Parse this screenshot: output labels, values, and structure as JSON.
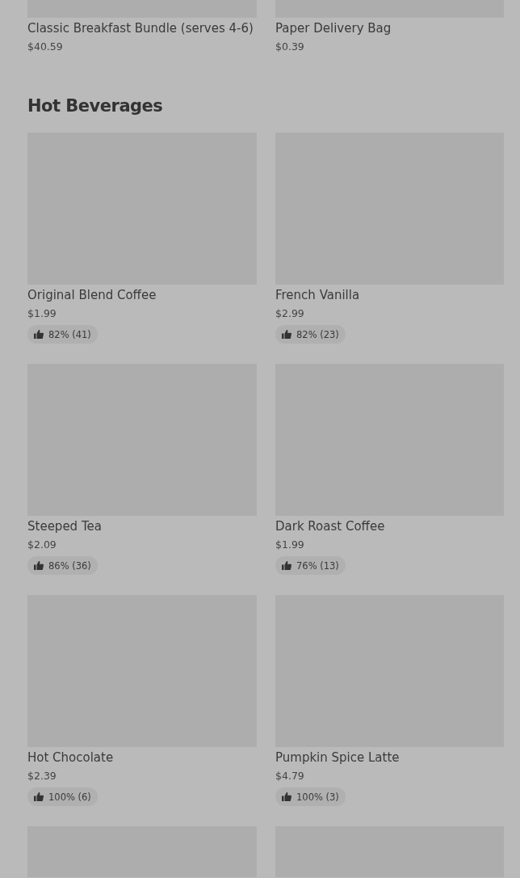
{
  "sections": [
    {
      "items": [
        {
          "name": "Classic Breakfast Bundle (serves 4-6)",
          "price": "$40.59"
        },
        {
          "name": "Paper Delivery Bag",
          "price": "$0.39"
        }
      ]
    },
    {
      "title": "Hot Beverages",
      "items": [
        {
          "name": "Original Blend Coffee",
          "price": "$1.99",
          "rating": "82% (41)"
        },
        {
          "name": "French Vanilla",
          "price": "$2.99",
          "rating": "82% (23)"
        },
        {
          "name": "Steeped Tea",
          "price": "$2.09",
          "rating": "86% (36)"
        },
        {
          "name": "Dark Roast Coffee",
          "price": "$1.99",
          "rating": "76% (13)"
        },
        {
          "name": "Hot Chocolate",
          "price": "$2.39",
          "rating": "100% (6)"
        },
        {
          "name": "Pumpkin Spice Latte",
          "price": "$4.79",
          "rating": "100% (3)"
        },
        {
          "kind": "picture"
        },
        {
          "kind": "picture"
        }
      ]
    }
  ]
}
